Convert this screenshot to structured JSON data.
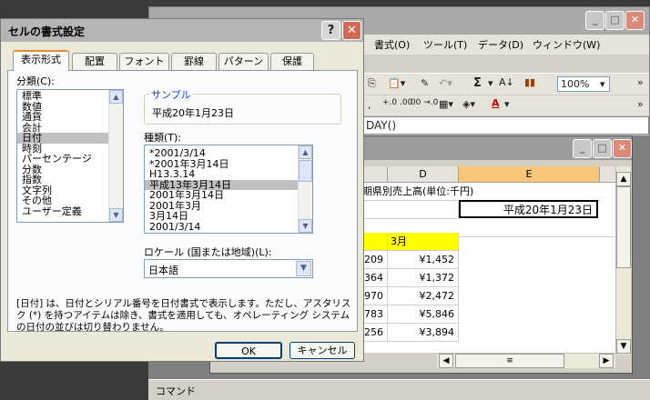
{
  "excel": {
    "menu": [
      "書式(O)",
      "ツール(T)",
      "データ(D)",
      "ウィンドウ(W)"
    ],
    "toolbar": {
      "zoom": "100%",
      "sigma": "Σ",
      "font_color": "A"
    },
    "formula_text": "DAY()",
    "status_text": "コマンド",
    "columns": [
      "D",
      "E"
    ],
    "title_cell": "半期県別売上高(単位:千円)",
    "date_cell": "平成20年1月23日",
    "month_header": "3月",
    "rows": [
      {
        "c": "209",
        "d": "¥1,452"
      },
      {
        "c": "364",
        "d": "¥1,372"
      },
      {
        "c": "970",
        "d": "¥2,472"
      },
      {
        "c": "783",
        "d": "¥5,846"
      },
      {
        "c": "256",
        "d": "¥3,894"
      }
    ],
    "colors": {
      "header_yellow": "#ffff00",
      "selected_col": "#f7c67a"
    }
  },
  "dialog": {
    "title": "セルの書式設定",
    "help": "?",
    "close": "✕",
    "tabs": [
      "表示形式",
      "配置",
      "フォント",
      "罫線",
      "パターン",
      "保護"
    ],
    "category_label": "分類(C):",
    "categories": [
      "標準",
      "数値",
      "通貨",
      "会計",
      "日付",
      "時刻",
      "パーセンテージ",
      "分数",
      "指数",
      "文字列",
      "その他",
      "ユーザー定義"
    ],
    "selected_category": "日付",
    "sample_label": "サンプル",
    "sample_value": "平成20年1月23日",
    "type_label": "種類(T):",
    "types": [
      "*2001/3/14",
      "*2001年3月14日",
      "H13.3.14",
      "平成13年3月14日",
      "2001年3月14日",
      "2001年3月",
      "3月14日",
      "2001/3/14"
    ],
    "selected_type": "平成13年3月14日",
    "locale_label": "ロケール (国または地域)(L):",
    "locale_value": "日本語",
    "description": "[日付] は、日付とシリアル番号を日付書式で表示します。ただし、アスタリスク (*) を持つアイテムは除き、書式を適用しても、オペレーティング システムの日付の並びは切り替わりません。",
    "ok": "OK",
    "cancel": "キャンセル"
  }
}
